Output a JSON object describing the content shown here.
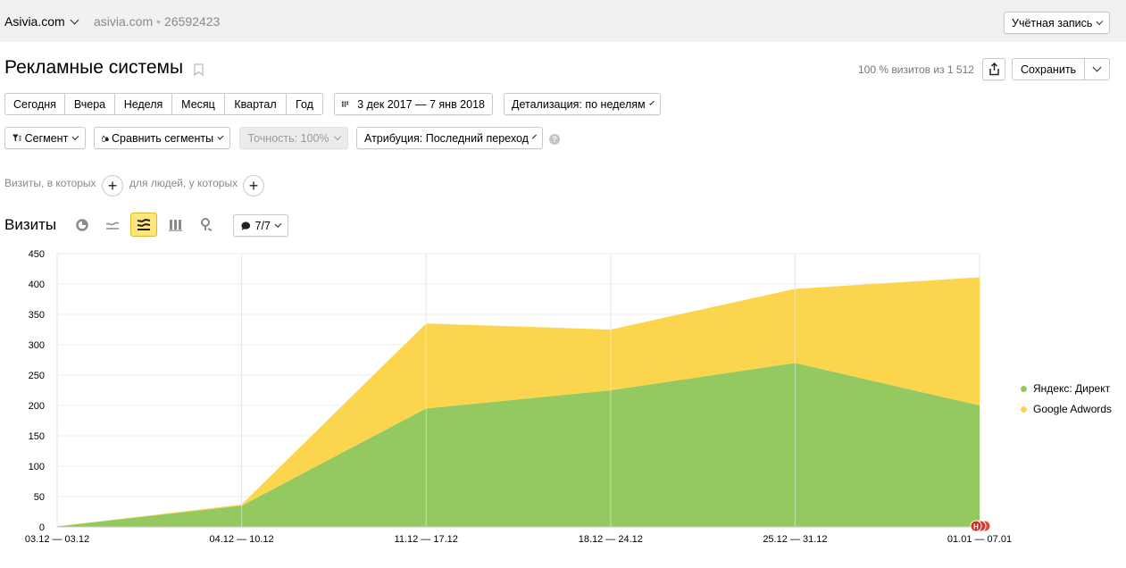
{
  "header": {
    "site_name": "Asivia.com",
    "host": "asivia.com",
    "separator": "•",
    "counter_id": "26592423",
    "account_label": "Учётная запись"
  },
  "report": {
    "title": "Рекламные системы",
    "visits_summary": "100 % визитов из 1 512",
    "save_label": "Сохранить"
  },
  "periods": [
    {
      "label": "Сегодня"
    },
    {
      "label": "Вчера"
    },
    {
      "label": "Неделя"
    },
    {
      "label": "Месяц"
    },
    {
      "label": "Квартал"
    },
    {
      "label": "Год"
    }
  ],
  "date_range": "3 дек 2017 — 7 янв 2018",
  "detail": "Детализация: по неделям",
  "toolbar": {
    "segment": "Сегмент",
    "compare": "Сравнить сегменты",
    "accuracy": "Точность: 100%",
    "attribution": "Атрибуция: Последний переход",
    "help": "?"
  },
  "filters": {
    "visits_where": "Визиты, в которых",
    "people_where": "для людей, у которых"
  },
  "chart_section": {
    "title": "Визиты",
    "series_count": "7/7"
  },
  "chart_data": {
    "type": "area",
    "stacked": true,
    "categories": [
      "03.12 — 03.12",
      "04.12 — 10.12",
      "11.12 — 17.12",
      "18.12 — 24.12",
      "25.12 — 31.12",
      "01.01 — 07.01"
    ],
    "series": [
      {
        "name": "Яндекс: Директ",
        "color": "#94c962",
        "values": [
          1,
          35,
          195,
          225,
          270,
          200
        ]
      },
      {
        "name": "Google Adwords",
        "color": "#fbd54e",
        "values": [
          0,
          2,
          140,
          100,
          122,
          211
        ]
      }
    ],
    "ylim": [
      0,
      450
    ],
    "yticks": [
      0,
      50,
      100,
      150,
      200,
      250,
      300,
      350,
      400,
      450
    ],
    "grid": true,
    "legend": "right"
  }
}
